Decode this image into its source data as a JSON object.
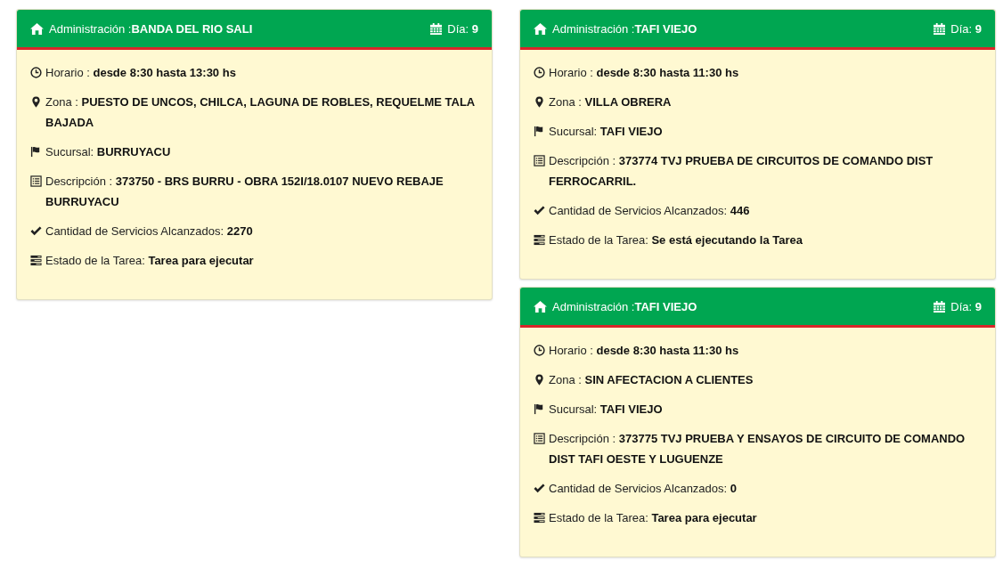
{
  "columns": [
    {
      "cards": [
        {
          "title": "Administración :**BANDA DEL RIO SALI**",
          "day": "Día: **9**",
          "fields": [
            {
              "kind": "schedule",
              "text": "Horario : **desde 8:30 hasta 13:30 hs**"
            },
            {
              "kind": "zone",
              "text": "Zona : **PUESTO DE UNCOS, CHILCA, LAGUNA DE ROBLES, REQUELME TALA BAJADA**"
            },
            {
              "kind": "branch",
              "text": "Sucursal: **BURRUYACU**"
            },
            {
              "kind": "description",
              "text": "Descripción : **373750 - BRS BURRU - OBRA 152I/18.0107 NUEVO REBAJE BURRUYACU**"
            },
            {
              "kind": "services",
              "text": "Cantidad de Servicios Alcanzados: **2270**"
            },
            {
              "kind": "status",
              "text": "Estado de la Tarea: **Tarea para ejecutar**"
            }
          ]
        }
      ]
    },
    {
      "cards": [
        {
          "title": "Administración :**TAFI VIEJO**",
          "day": "Día: **9**",
          "fields": [
            {
              "kind": "schedule",
              "text": "Horario : **desde 8:30 hasta 11:30 hs**"
            },
            {
              "kind": "zone",
              "text": "Zona : **VILLA OBRERA**"
            },
            {
              "kind": "branch",
              "text": "Sucursal: **TAFI VIEJO**"
            },
            {
              "kind": "description",
              "text": "Descripción : **373774 TVJ PRUEBA DE CIRCUITOS DE COMANDO DIST FERROCARRIL.**"
            },
            {
              "kind": "services",
              "text": "Cantidad de Servicios Alcanzados: **446**"
            },
            {
              "kind": "status",
              "text": "Estado de la Tarea: **Se está ejecutando la Tarea**"
            }
          ]
        },
        {
          "title": "Administración :**TAFI VIEJO**",
          "day": "Día: **9**",
          "fields": [
            {
              "kind": "schedule",
              "text": "Horario : **desde 8:30 hasta 11:30 hs**"
            },
            {
              "kind": "zone",
              "text": "Zona : **SIN AFECTACION A CLIENTES**"
            },
            {
              "kind": "branch",
              "text": "Sucursal: **TAFI VIEJO**"
            },
            {
              "kind": "description",
              "text": "Descripción : **373775 TVJ PRUEBA Y ENSAYOS DE CIRCUITO DE COMANDO DIST TAFI OESTE Y LUGUENZE**"
            },
            {
              "kind": "services",
              "text": "Cantidad de Servicios Alcanzados: **0**"
            },
            {
              "kind": "status",
              "text": "Estado de la Tarea: **Tarea para ejecutar**"
            }
          ]
        }
      ]
    }
  ]
}
